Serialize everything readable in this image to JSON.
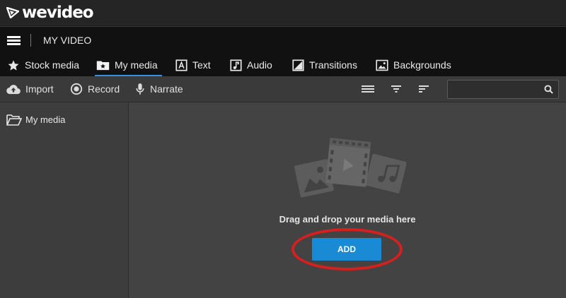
{
  "app": {
    "logo_text": "wevideo"
  },
  "project": {
    "title": "MY VIDEO"
  },
  "tabs": [
    {
      "label": "Stock media",
      "icon": "star-icon"
    },
    {
      "label": "My media",
      "icon": "folder-star-icon",
      "active": true
    },
    {
      "label": "Text",
      "icon": "text-icon"
    },
    {
      "label": "Audio",
      "icon": "music-note-icon"
    },
    {
      "label": "Transitions",
      "icon": "transition-icon"
    },
    {
      "label": "Backgrounds",
      "icon": "image-icon"
    }
  ],
  "toolbar": {
    "import_label": "Import",
    "record_label": "Record",
    "narrate_label": "Narrate",
    "view_icons": [
      "list-view-icon",
      "filter-icon",
      "sort-icon"
    ]
  },
  "search": {
    "placeholder": "",
    "value": ""
  },
  "sidebar": {
    "items": [
      {
        "label": "My media",
        "icon": "folder-open-icon"
      }
    ]
  },
  "main": {
    "drop_text": "Drag and drop your media here",
    "add_label": "ADD"
  },
  "colors": {
    "accent": "#1a8ad4",
    "tab_underline": "#3a8fd8",
    "highlight": "#d6201f"
  }
}
